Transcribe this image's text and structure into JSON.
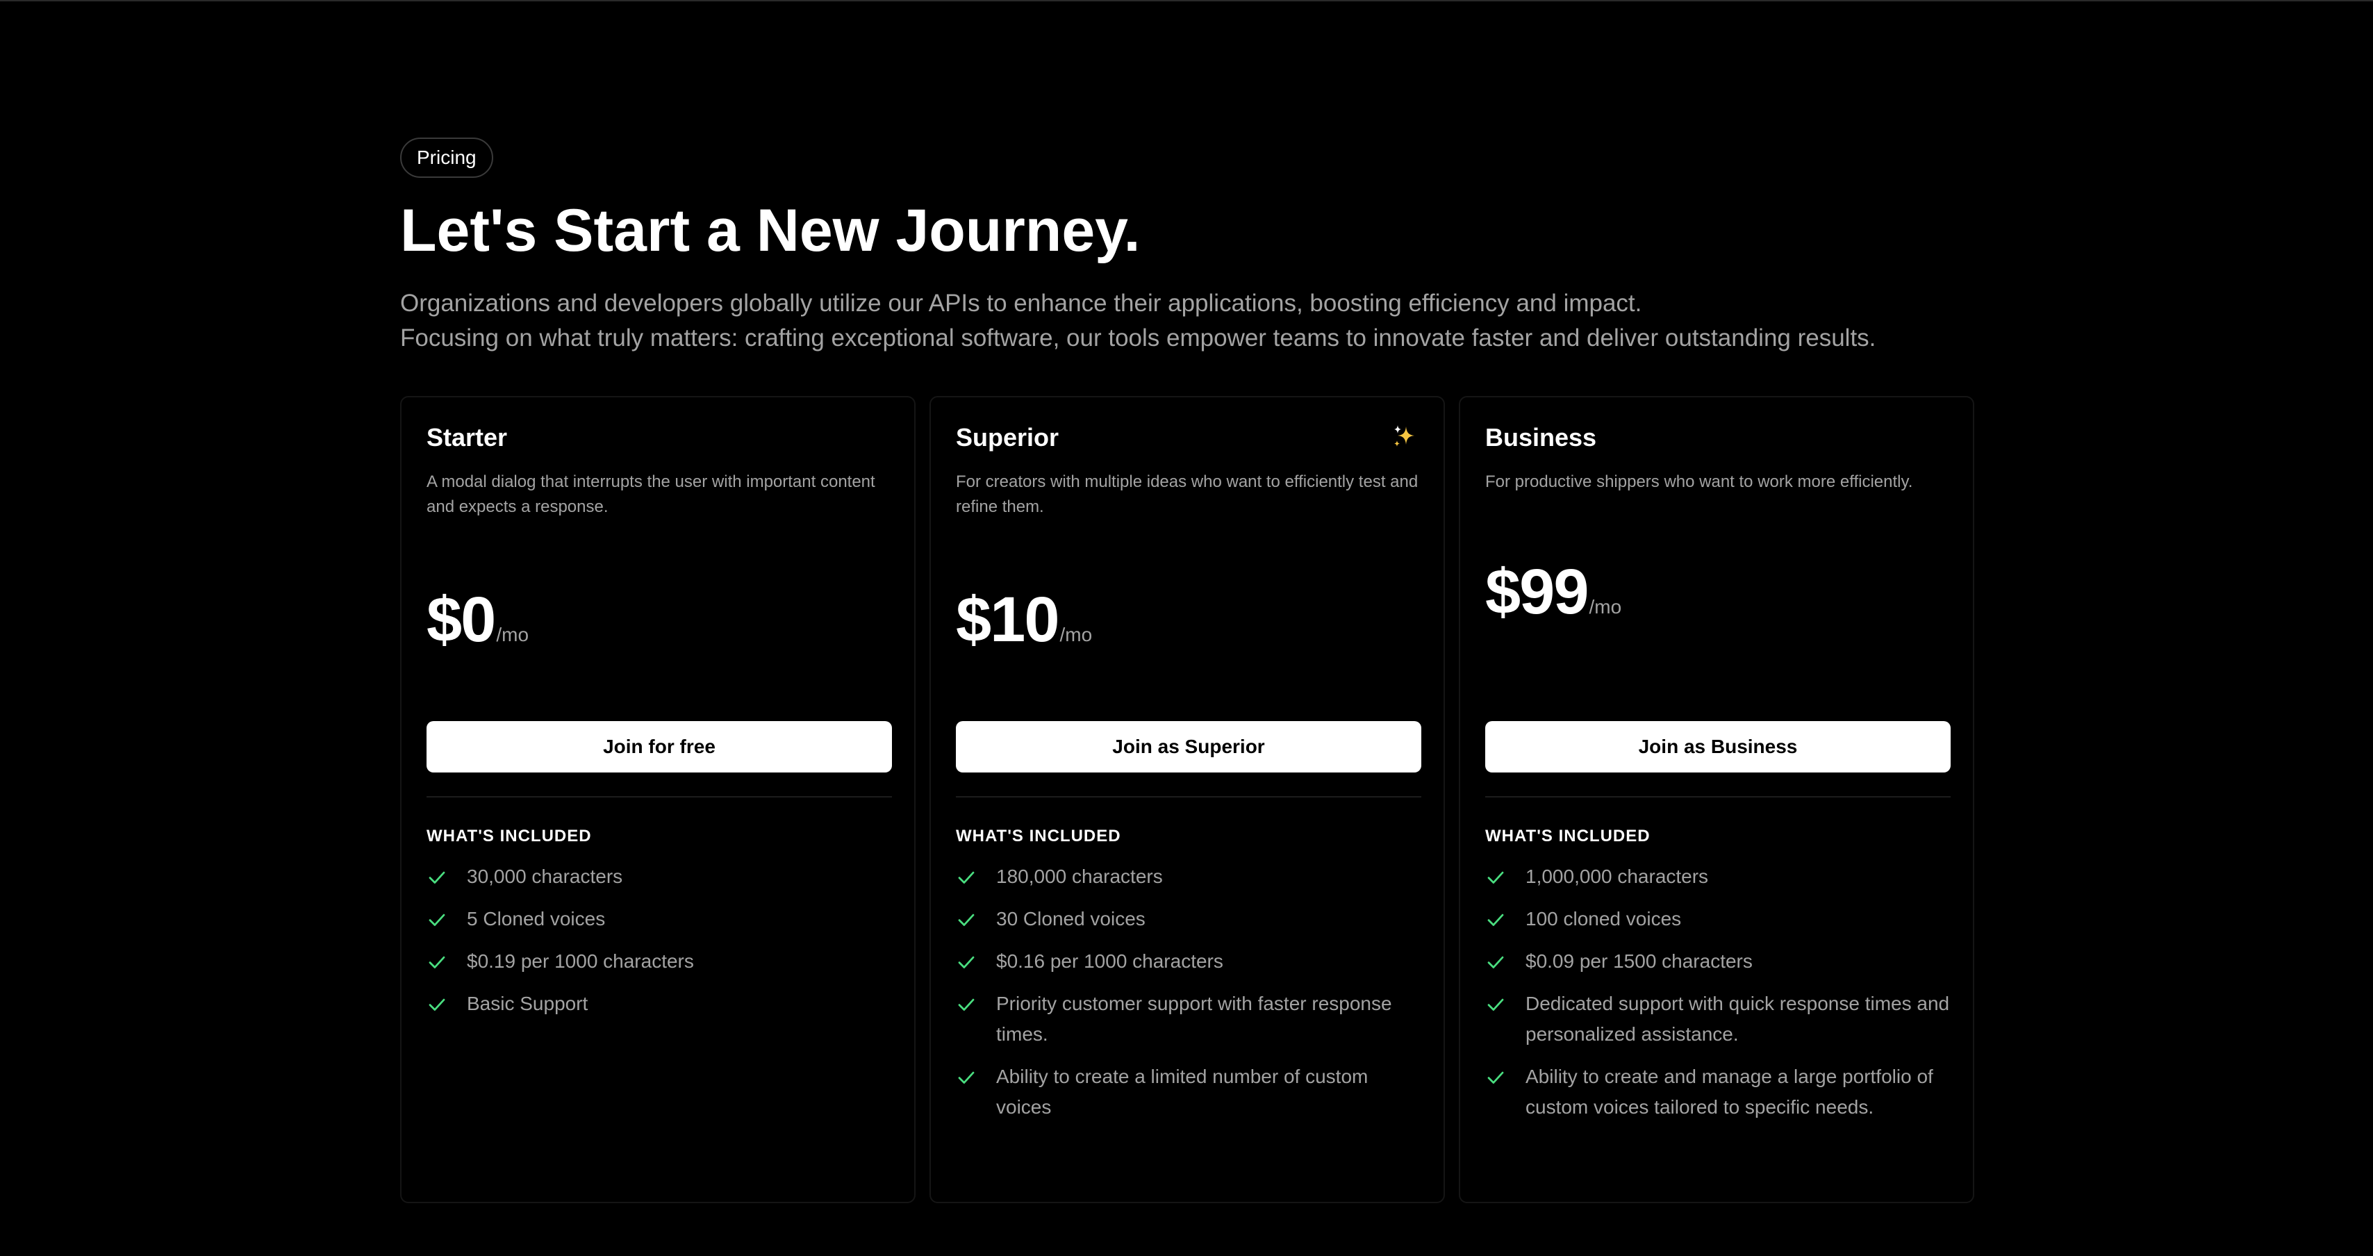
{
  "header": {
    "badge": "Pricing",
    "title": "Let's Start a New Journey.",
    "subtitle_line1": "Organizations and developers globally utilize our APIs to enhance their applications, boosting efficiency and impact.",
    "subtitle_line2": "Focusing on what truly matters: crafting exceptional software, our tools empower teams to innovate faster and deliver outstanding results."
  },
  "colors": {
    "background": "#000000",
    "card_border": "#151515",
    "muted_text": "#a3a3a3",
    "check": "#4ade80",
    "sparkle": "#f5c542"
  },
  "plans": [
    {
      "name": "Starter",
      "description": "A modal dialog that interrupts the user with important content and expects a response.",
      "price": "$0",
      "period": "/mo",
      "button": "Join for free",
      "included_heading": "WHAT'S INCLUDED",
      "features": [
        "30,000 characters",
        "5 Cloned voices",
        "$0.19 per 1000 characters",
        "Basic Support"
      ]
    },
    {
      "name": "Superior",
      "description": "For creators with multiple ideas who want to efficiently test and refine them.",
      "price": "$10",
      "period": "/mo",
      "button": "Join as Superior",
      "included_heading": "WHAT'S INCLUDED",
      "icon": "sparkle-icon",
      "features": [
        "180,000 characters",
        "30 Cloned voices",
        "$0.16 per 1000 characters",
        "Priority customer support with faster response times.",
        "Ability to create a limited number of custom voices"
      ]
    },
    {
      "name": "Business",
      "description": "For productive shippers who want to work more efficiently.",
      "price": "$99",
      "period": "/mo",
      "button": "Join as Business",
      "included_heading": "WHAT'S INCLUDED",
      "features": [
        "1,000,000 characters",
        "100 cloned voices",
        "$0.09 per 1500 characters",
        "Dedicated support with quick response times and personalized assistance.",
        "Ability to create and manage a large portfolio of custom voices tailored to specific needs."
      ]
    }
  ]
}
